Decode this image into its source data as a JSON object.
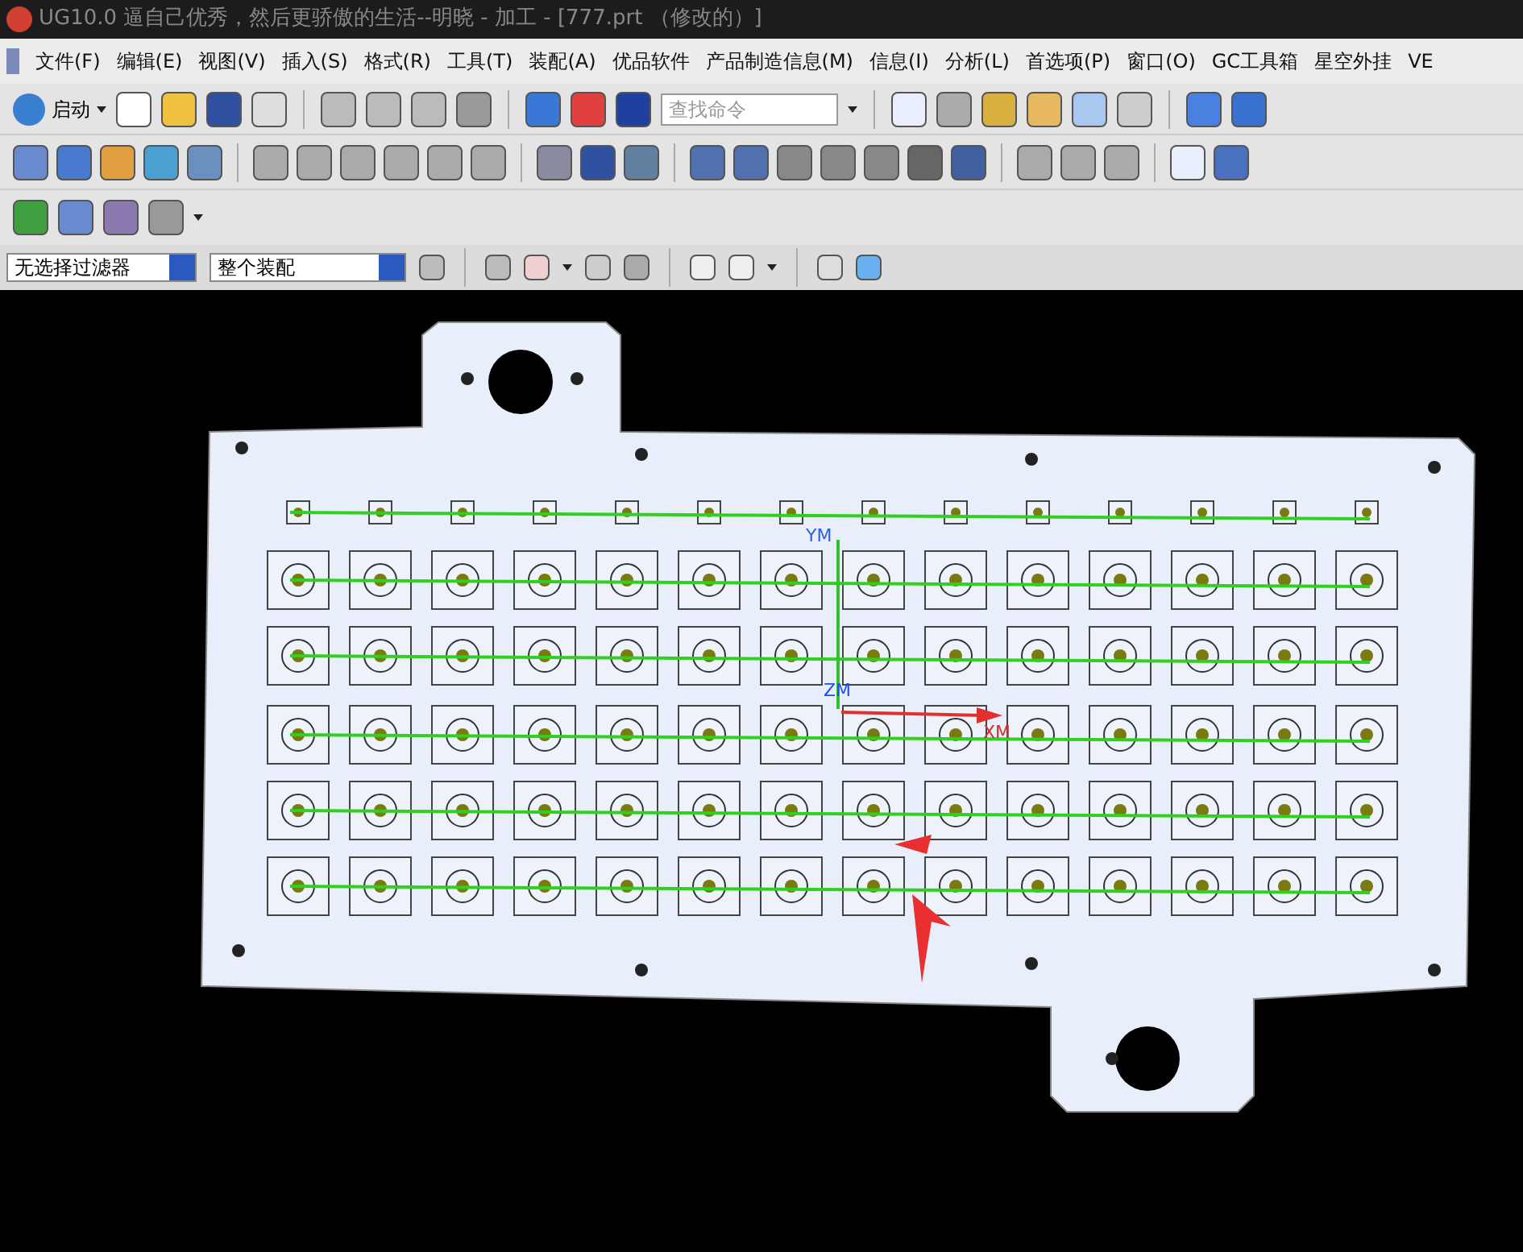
{
  "window": {
    "title": "UG10.0 逼自己优秀，然后更骄傲的生活--明晓 - 加工 - [777.prt （修改的）]"
  },
  "menu": [
    "文件(F)",
    "编辑(E)",
    "视图(V)",
    "插入(S)",
    "格式(R)",
    "工具(T)",
    "装配(A)",
    "优品软件",
    "产品制造信息(M)",
    "信息(I)",
    "分析(L)",
    "首选项(P)",
    "窗口(O)",
    "GC工具箱",
    "星空外挂",
    "VE"
  ],
  "toolbar": {
    "start_label": "启动",
    "search": {
      "placeholder": "查找命令"
    }
  },
  "selection_bar": {
    "filter": "无选择过滤器",
    "scope": "整个装配"
  },
  "viewport": {
    "axis_labels": {
      "y": "YM",
      "z": "ZM",
      "x": "XM"
    }
  }
}
